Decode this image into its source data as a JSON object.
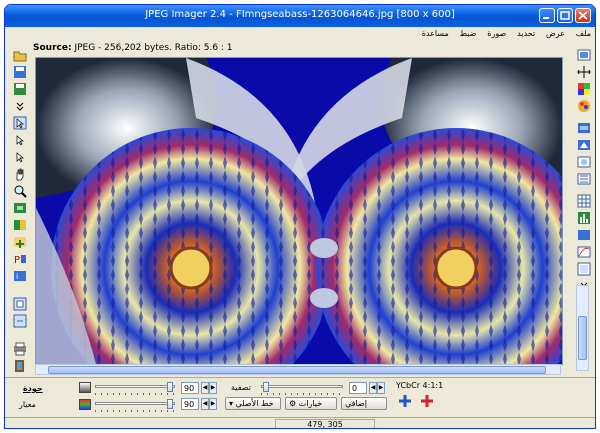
{
  "window": {
    "title": "JPEG Imager 2.4 - FImngseabass-1263064646.jpg [800 x 600]"
  },
  "menu": [
    "ملف",
    "عرض",
    "تحديد",
    "صورة",
    "ضبط",
    "مساعدة"
  ],
  "source": {
    "label": "Source:",
    "text": "JPEG - 256,202 bytes. Ratio: 5.6 : 1"
  },
  "bottom": {
    "quality_label": "جودة",
    "standard_label": "معيار",
    "quality_value": "90",
    "standard_value": "90",
    "smoothing_label": "تصفية",
    "smoothing_value": "0",
    "font_label": "خط الأصلي",
    "options_label": "خيارات",
    "extra_label": "إضافي",
    "ycbcr_label": "YCbCr 4:1:1"
  },
  "status": {
    "coords": "479, 305"
  },
  "icons": {
    "left": [
      "open-icon",
      "save-icon",
      "save-as-icon",
      "more-icon",
      "select-icon",
      "crop-icon",
      "lasso-icon",
      "hand-icon",
      "zoom-icon",
      "fit-icon",
      "compare-icon",
      "rotate-icon",
      "flip-icon",
      "info-icon",
      "copy-icon",
      "paste-icon",
      "print-icon",
      "exit-icon"
    ],
    "right": [
      "preview-icon",
      "resize-icon",
      "colors-icon",
      "palette-icon",
      "filter-icon",
      "sharpen-icon",
      "blur-icon",
      "emboss-icon",
      "grid-icon",
      "histogram-icon",
      "levels-icon",
      "curves-icon",
      "layers-icon",
      "more-icon"
    ]
  },
  "colors": {
    "accent": "#0a5ddc",
    "image_bg": "#0000a0"
  }
}
